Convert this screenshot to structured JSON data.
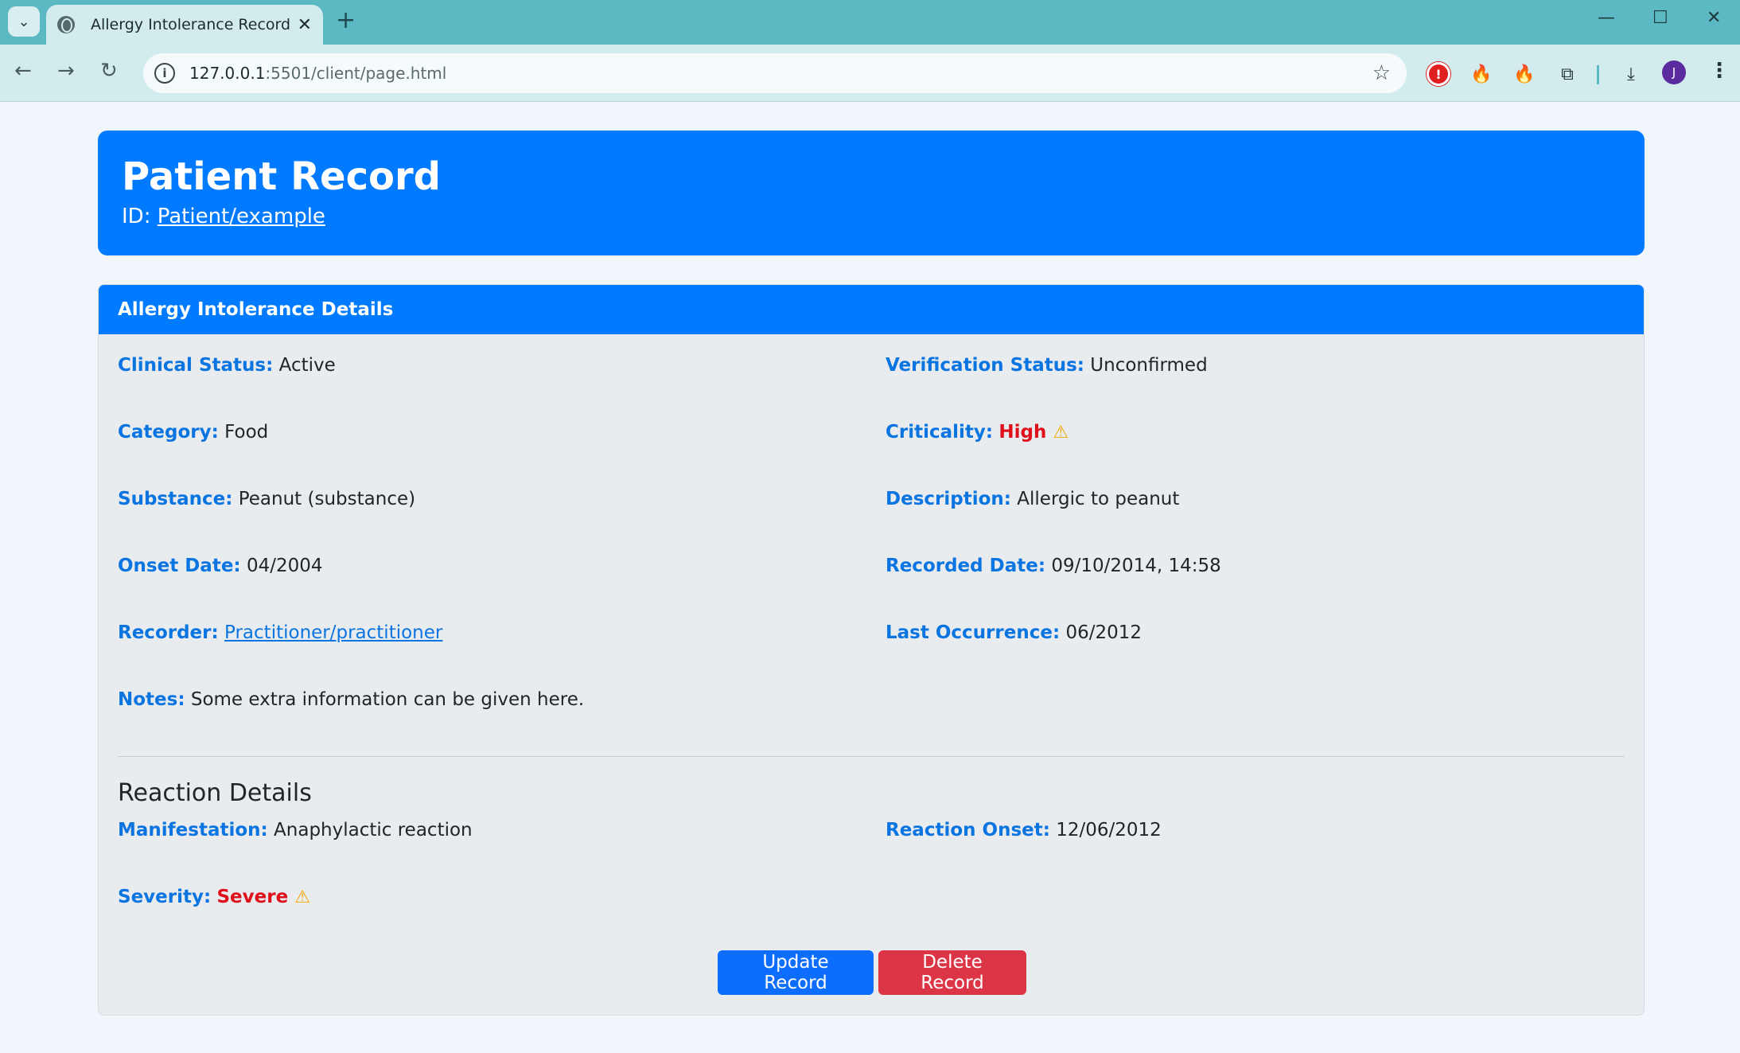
{
  "browser": {
    "tab_title": "Allergy Intolerance Record",
    "url_host": "127.0.0.1",
    "url_rest": ":5501/client/page.html",
    "avatar_letter": "J"
  },
  "hero": {
    "title": "Patient Record",
    "id_label": "ID:",
    "id_link": "Patient/example"
  },
  "card": {
    "header": "Allergy Intolerance Details",
    "fields": {
      "clinical_status": {
        "label": "Clinical Status:",
        "value": "Active"
      },
      "verification_status": {
        "label": "Verification Status:",
        "value": "Unconfirmed"
      },
      "category": {
        "label": "Category:",
        "value": "Food"
      },
      "criticality": {
        "label": "Criticality:",
        "value": "High"
      },
      "substance": {
        "label": "Substance:",
        "value": "Peanut (substance)"
      },
      "description": {
        "label": "Description:",
        "value": "Allergic to peanut"
      },
      "onset_date": {
        "label": "Onset Date:",
        "value": "04/2004"
      },
      "recorded_date": {
        "label": "Recorded Date:",
        "value": "09/10/2014, 14:58"
      },
      "recorder": {
        "label": "Recorder:",
        "value": "Practitioner/practitioner"
      },
      "last_occurrence": {
        "label": "Last Occurrence:",
        "value": "06/2012"
      },
      "notes": {
        "label": "Notes:",
        "value": "Some extra information can be given here."
      }
    },
    "reaction": {
      "title": "Reaction Details",
      "manifestation": {
        "label": "Manifestation:",
        "value": "Anaphylactic reaction"
      },
      "reaction_onset": {
        "label": "Reaction Onset:",
        "value": "12/06/2012"
      },
      "severity": {
        "label": "Severity:",
        "value": "Severe"
      }
    },
    "buttons": {
      "update": "Update Record",
      "delete": "Delete Record"
    }
  },
  "colors": {
    "primary": "#007bff",
    "danger": "#dc3545",
    "alert_red": "#e0101a",
    "warning": "#f2a600"
  },
  "icons": {
    "criticality_warning": "warning-triangle-icon",
    "severity_warning": "warning-triangle-icon"
  }
}
